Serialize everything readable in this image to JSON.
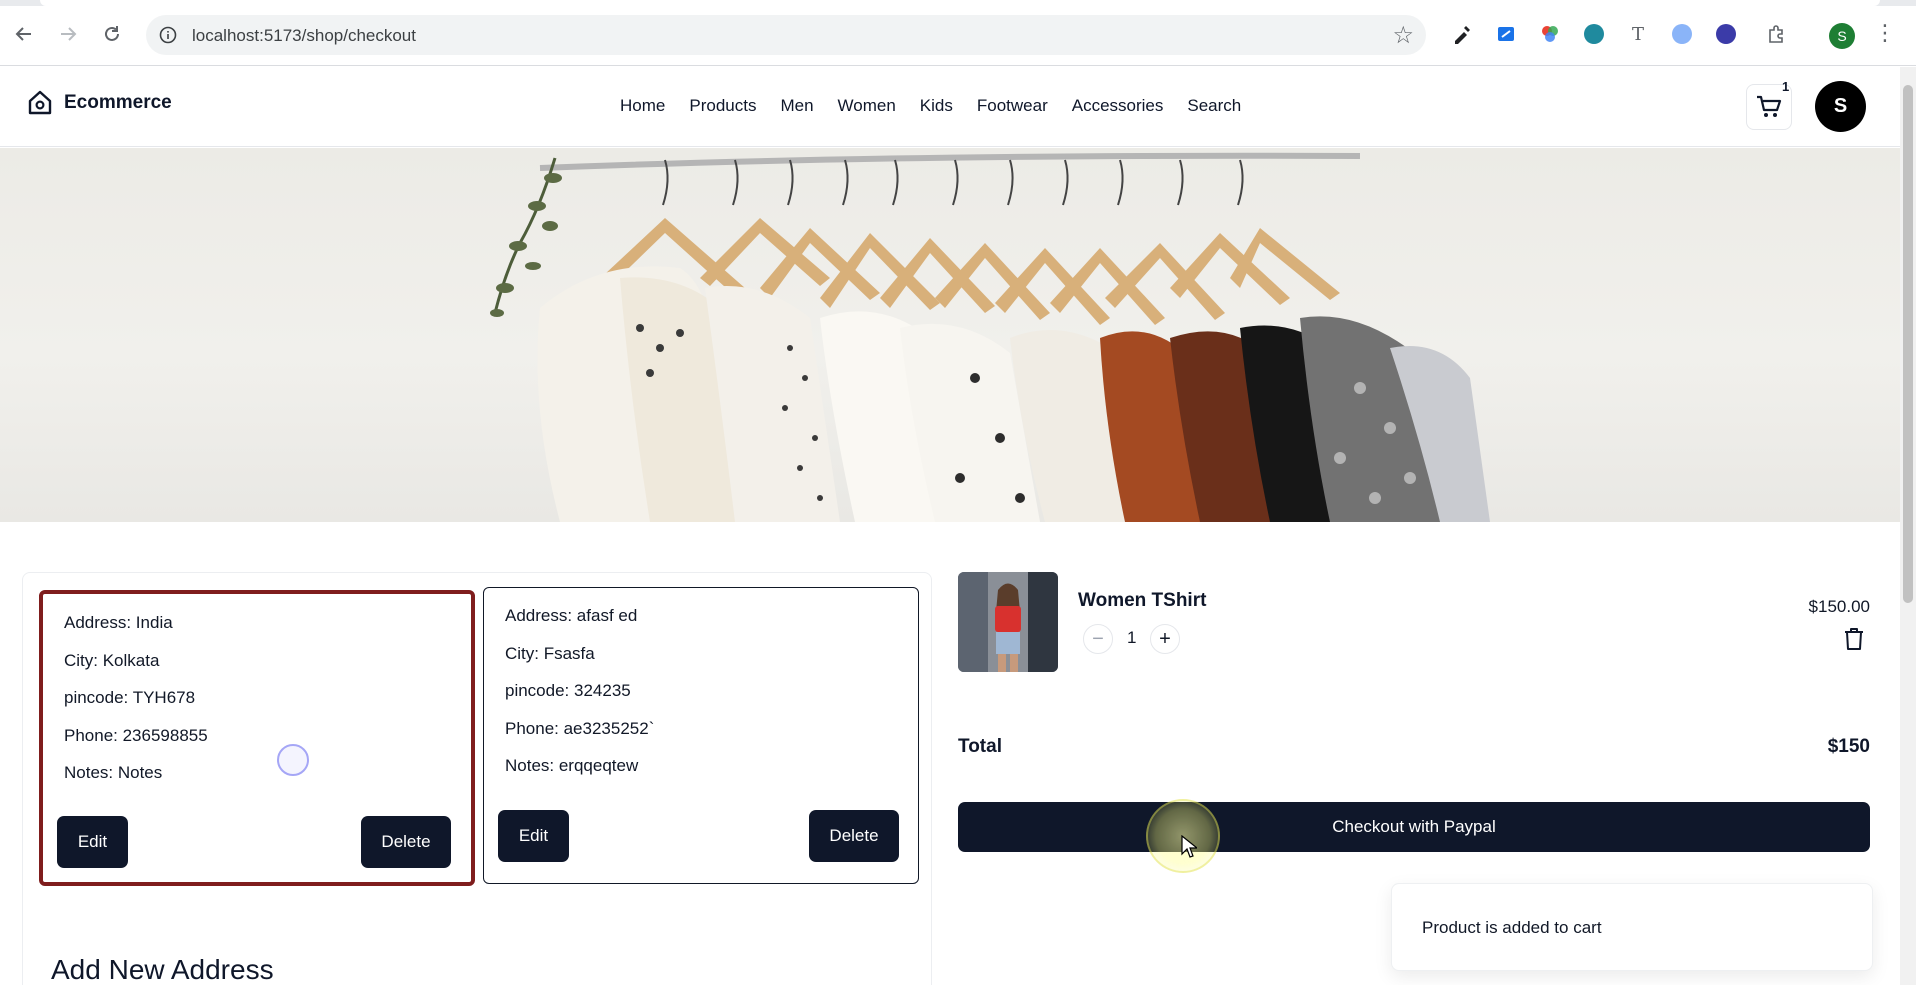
{
  "browser": {
    "url": "localhost:5173/shop/checkout",
    "profile_initial": "S"
  },
  "header": {
    "brand": "Ecommerce",
    "nav": [
      "Home",
      "Products",
      "Men",
      "Women",
      "Kids",
      "Footwear",
      "Accessories",
      "Search"
    ],
    "cart_count": "1",
    "avatar_initial": "S"
  },
  "addresses": [
    {
      "selected": true,
      "address": "Address: India",
      "city": "City: Kolkata",
      "pincode": "pincode: TYH678",
      "phone": "Phone: 236598855",
      "notes": "Notes: Notes",
      "edit_label": "Edit",
      "delete_label": "Delete"
    },
    {
      "selected": false,
      "address": "Address: afasf ed",
      "city": "City: Fsasfa",
      "pincode": "pincode: 324235",
      "phone": "Phone: ae3235252`",
      "notes": "Notes: erqqeqtew",
      "edit_label": "Edit",
      "delete_label": "Delete"
    }
  ],
  "add_address_title": "Add New Address",
  "cart": {
    "item_title": "Women TShirt",
    "quantity": "1",
    "price": "$150.00",
    "total_label": "Total",
    "total_value": "$150",
    "checkout_label": "Checkout with Paypal"
  },
  "toast": {
    "message": "Product is added to cart"
  },
  "colors": {
    "primary": "#0f172a",
    "selected_border": "#7f1d1d"
  }
}
